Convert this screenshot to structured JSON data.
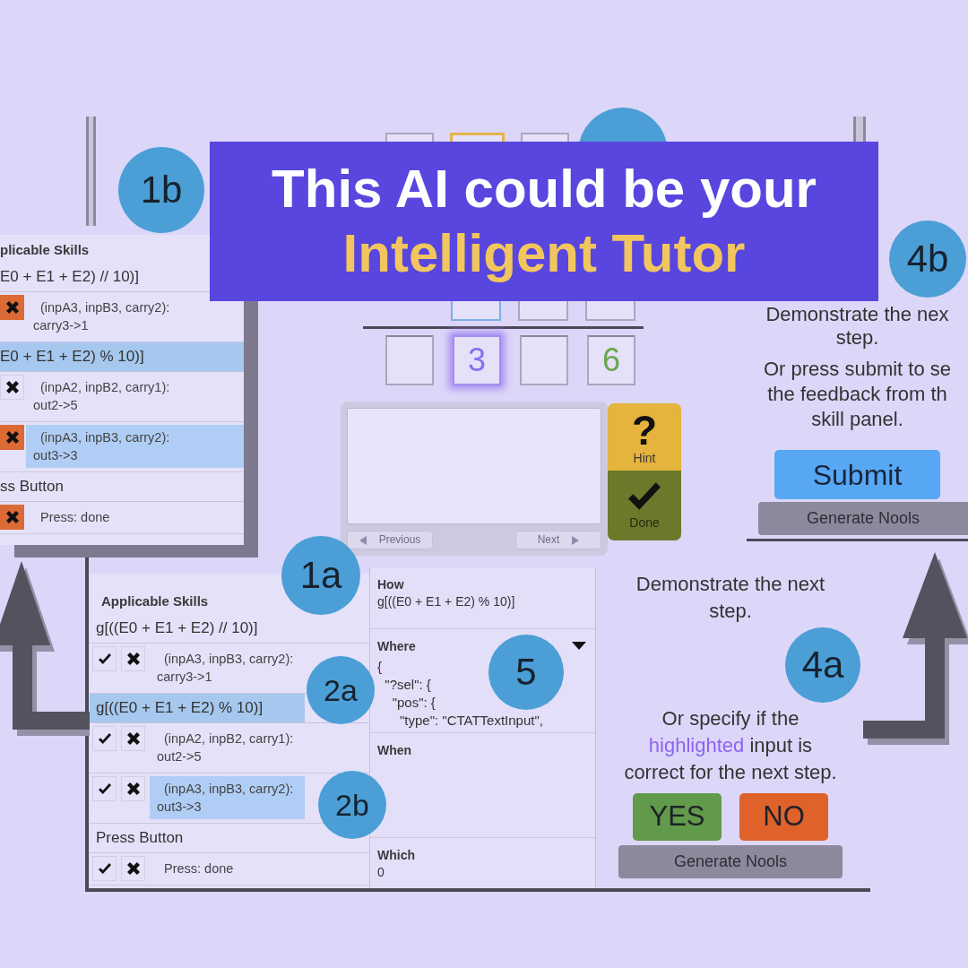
{
  "banner": {
    "title": "This AI could be your",
    "highlight": "Intelligent Tutor"
  },
  "skills_panel_top": {
    "header": "plicable Skills",
    "callout": "1b",
    "groups": [
      {
        "name": "E0 + E1 + E2) // 10)]",
        "selected": false,
        "skills": [
          {
            "text": "(inpA3, inpB3, carry2): carry3->1",
            "rejected": true,
            "selected": false
          }
        ]
      },
      {
        "name": "E0 + E1 + E2) % 10)]",
        "selected": true,
        "skills": [
          {
            "text": "(inpA2, inpB2, carry1): out2->5",
            "rejected": false,
            "selected": false
          },
          {
            "text": "(inpA3, inpB3, carry2): out3->3",
            "rejected": true,
            "selected": true
          }
        ]
      },
      {
        "name": "ss Button",
        "selected": false,
        "skills": [
          {
            "text": "Press: done",
            "rejected": true,
            "selected": false
          }
        ]
      }
    ]
  },
  "tutor": {
    "top_row_cells": [
      {
        "selected": false
      },
      {
        "selected": true
      },
      {
        "selected": false
      }
    ],
    "third_row_cells": [
      {
        "selected": true
      },
      {
        "selected": false
      },
      {
        "selected": false
      }
    ],
    "answer_cells": [
      {
        "highlighted": false
      },
      {
        "value": "3",
        "highlighted": true,
        "correct": false
      },
      {
        "highlighted": false
      },
      {
        "value": "6",
        "highlighted": false,
        "correct": true
      }
    ],
    "nav_buttons": [
      {
        "label": "Previous",
        "kind": "previous",
        "disabled": true
      },
      {
        "label": "Next",
        "kind": "next",
        "disabled": true
      }
    ],
    "hint_button": {
      "symbol": "?",
      "label": "Hint"
    },
    "done_button": {
      "label": "Done"
    }
  },
  "skills_panel_bottom": {
    "header": "Applicable Skills",
    "callout": "1a",
    "groups": [
      {
        "name": "g[((E0 + E1 + E2) // 10)]",
        "selected": false,
        "skills": [
          {
            "text": "(inpA3, inpB3, carry2): carry3->1",
            "accepted": false,
            "rejected": false,
            "selected": false
          }
        ]
      },
      {
        "name": "g[((E0 + E1 + E2) % 10)]",
        "selected": true,
        "callout": "2a",
        "skills": [
          {
            "text": "(inpA2, inpB2, carry1): out2->5",
            "accepted": false,
            "rejected": false,
            "selected": false
          },
          {
            "text": "(inpA3, inpB3, carry2): out3->3",
            "accepted": false,
            "rejected": false,
            "selected": true,
            "callout": "2b"
          }
        ]
      },
      {
        "name": "Press Button",
        "selected": false,
        "skills": [
          {
            "text": "Press: done",
            "accepted": false,
            "rejected": false,
            "selected": false
          }
        ]
      }
    ]
  },
  "details_panel": {
    "callout": "5",
    "sections": [
      {
        "title": "How",
        "kind": "text",
        "body": "g[((E0 + E1 + E2) % 10)]"
      },
      {
        "title": "Where",
        "kind": "code",
        "dropdown": true,
        "lines": [
          "{",
          "  \"?sel\": {",
          "    \"pos\": {",
          "      \"type\": \"CTATTextInput\","
        ]
      },
      {
        "title": "When"
      },
      {
        "title": "Which",
        "kind": "text",
        "body": "0"
      }
    ]
  },
  "demo_panel": {
    "prompt": "Demonstrate the next step.",
    "callout": "4a",
    "question": [
      {
        "text": "Or specify if the "
      },
      {
        "text": "highlighted",
        "kind": "highlight"
      },
      {
        "text": " input is correct for the next step."
      }
    ],
    "answer_buttons": [
      {
        "label": "YES",
        "kind": "yes"
      },
      {
        "label": "NO",
        "kind": "no"
      }
    ],
    "generate_button": "Generate Nools"
  },
  "submit_panel": {
    "prompt": "Demonstrate the nex\nstep.",
    "callout": "4b",
    "message": "Or press submit to se\nthe feedback from th\nskill panel.",
    "submit_button": "Submit",
    "generate_button": "Generate Nools"
  }
}
